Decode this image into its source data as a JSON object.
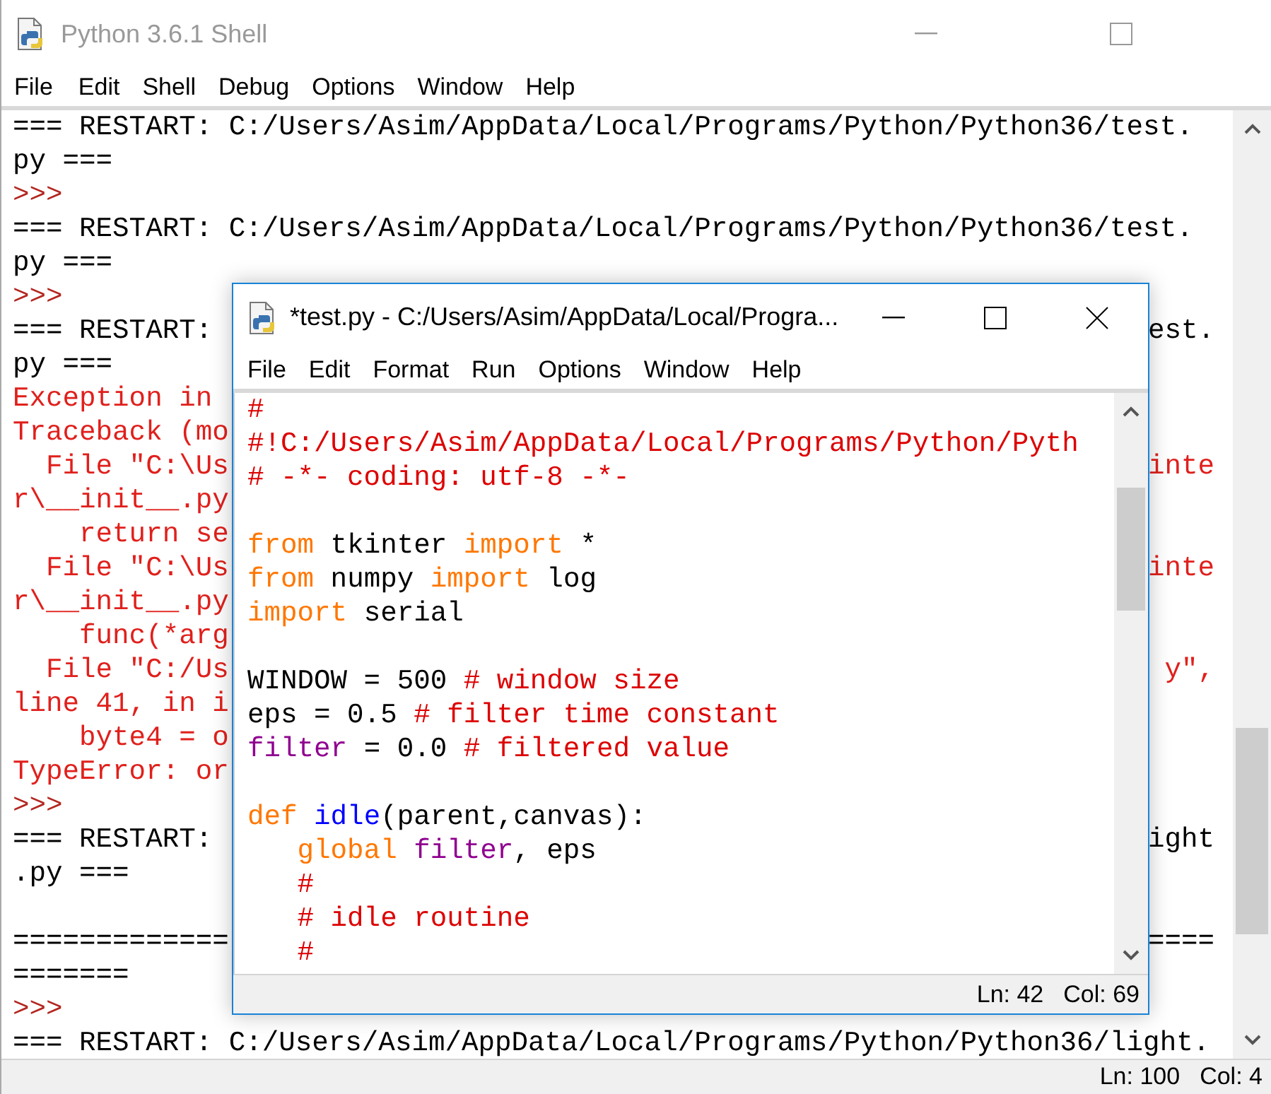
{
  "shell": {
    "title": "Python 3.6.1 Shell",
    "active": false,
    "menu": [
      "File",
      "Edit",
      "Shell",
      "Debug",
      "Options",
      "Window",
      "Help"
    ],
    "lines": [
      {
        "kind": "restart",
        "text": "=== RESTART: C:/Users/Asim/AppData/Local/Programs/Python/Python36/test."
      },
      {
        "kind": "restart",
        "text": "py ==="
      },
      {
        "kind": "prompt",
        "text": ">>>"
      },
      {
        "kind": "restart",
        "text": "=== RESTART: C:/Users/Asim/AppData/Local/Programs/Python/Python36/test."
      },
      {
        "kind": "restart",
        "text": "py ==="
      },
      {
        "kind": "prompt",
        "text": ">>>"
      },
      {
        "kind": "restart",
        "text": "=== RESTART:",
        "right": "est."
      },
      {
        "kind": "restart",
        "text": "py ==="
      },
      {
        "kind": "error",
        "text": "Exception in"
      },
      {
        "kind": "error",
        "text": "Traceback (mo"
      },
      {
        "kind": "error",
        "text": "  File \"C:\\Us",
        "right": "inte"
      },
      {
        "kind": "error",
        "text": "r\\__init__.py"
      },
      {
        "kind": "error",
        "text": "    return se"
      },
      {
        "kind": "error",
        "text": "  File \"C:\\Us",
        "right": "inte"
      },
      {
        "kind": "error",
        "text": "r\\__init__.py"
      },
      {
        "kind": "error",
        "text": "    func(*arg"
      },
      {
        "kind": "error",
        "text": "  File \"C:/Us",
        "right": "y\","
      },
      {
        "kind": "error",
        "text": "line 41, in i"
      },
      {
        "kind": "error",
        "text": "    byte4 = o"
      },
      {
        "kind": "error",
        "text": "TypeError: or"
      },
      {
        "kind": "prompt",
        "text": ">>>"
      },
      {
        "kind": "restart",
        "text": "=== RESTART:",
        "right": "ight"
      },
      {
        "kind": "restart",
        "text": ".py ==="
      },
      {
        "kind": "blank"
      },
      {
        "kind": "restart",
        "text": "=============",
        "right": "===="
      },
      {
        "kind": "restart",
        "text": "======="
      },
      {
        "kind": "prompt",
        "text": ">>>"
      },
      {
        "kind": "restart",
        "text": "=== RESTART: C:/Users/Asim/AppData/Local/Programs/Python/Python36/light."
      }
    ],
    "status": {
      "line": "Ln: 100",
      "col": "Col: 4"
    }
  },
  "editor": {
    "title": "*test.py - C:/Users/Asim/AppData/Local/Progra...",
    "active": true,
    "menu": [
      "File",
      "Edit",
      "Format",
      "Run",
      "Options",
      "Window",
      "Help"
    ],
    "lines": [
      {
        "tokens": [
          {
            "kind": "comment",
            "text": "#"
          }
        ]
      },
      {
        "tokens": [
          {
            "kind": "comment",
            "text": "#!C:/Users/Asim/AppData/Local/Programs/Python/Pyth"
          }
        ]
      },
      {
        "tokens": [
          {
            "kind": "comment",
            "text": "# -*- coding: utf-8 -*-"
          }
        ]
      },
      {
        "kind": "blank"
      },
      {
        "tokens": [
          {
            "kind": "keyword",
            "text": "from"
          },
          {
            "kind": "plain",
            "text": " tkinter "
          },
          {
            "kind": "keyword",
            "text": "import"
          },
          {
            "kind": "plain",
            "text": " *"
          }
        ]
      },
      {
        "tokens": [
          {
            "kind": "keyword",
            "text": "from"
          },
          {
            "kind": "plain",
            "text": " numpy "
          },
          {
            "kind": "keyword",
            "text": "import"
          },
          {
            "kind": "plain",
            "text": " log"
          }
        ]
      },
      {
        "tokens": [
          {
            "kind": "keyword",
            "text": "import"
          },
          {
            "kind": "plain",
            "text": " serial"
          }
        ]
      },
      {
        "kind": "blank"
      },
      {
        "tokens": [
          {
            "kind": "plain",
            "text": "WINDOW = 500 "
          },
          {
            "kind": "comment",
            "text": "# window size"
          }
        ]
      },
      {
        "tokens": [
          {
            "kind": "plain",
            "text": "eps = 0.5 "
          },
          {
            "kind": "comment",
            "text": "# filter time constant"
          }
        ]
      },
      {
        "tokens": [
          {
            "kind": "builtin",
            "text": "filter"
          },
          {
            "kind": "plain",
            "text": " = 0.0 "
          },
          {
            "kind": "comment",
            "text": "# filtered value"
          }
        ]
      },
      {
        "kind": "blank"
      },
      {
        "tokens": [
          {
            "kind": "keyword",
            "text": "def"
          },
          {
            "kind": "definition",
            "text": " idle"
          },
          {
            "kind": "plain",
            "text": "(parent,canvas):"
          }
        ]
      },
      {
        "tokens": [
          {
            "kind": "keyword",
            "text": "   global"
          },
          {
            "kind": "builtin",
            "text": " filter"
          },
          {
            "kind": "plain",
            "text": ", eps"
          }
        ]
      },
      {
        "tokens": [
          {
            "kind": "comment",
            "text": "   #"
          }
        ]
      },
      {
        "tokens": [
          {
            "kind": "comment",
            "text": "   # idle routine"
          }
        ]
      },
      {
        "tokens": [
          {
            "kind": "comment",
            "text": "   #"
          }
        ]
      }
    ],
    "status": {
      "line": "Ln: 42",
      "col": "Col: 69"
    }
  }
}
